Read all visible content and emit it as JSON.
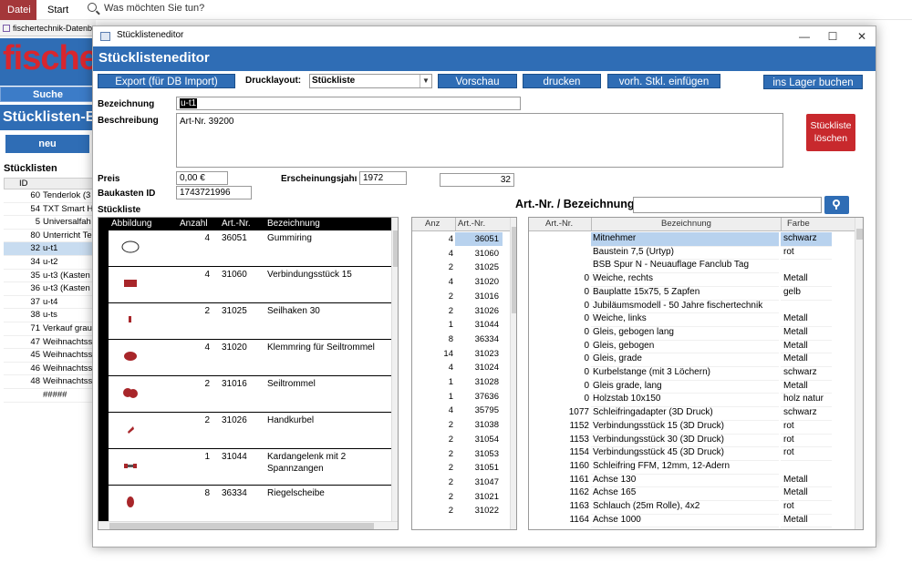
{
  "ribbon": {
    "datei": "Datei",
    "start": "Start",
    "tellme": "Was möchten Sie tun?"
  },
  "bg": {
    "tab": "fischertechnik-Datenb",
    "logo": "fische",
    "suche": "Suche",
    "title": "Stücklisten-Ed",
    "neu": "neu",
    "list_label": "Stücklisten",
    "id_header": "ID",
    "rows": [
      {
        "id": "60",
        "name": "Tenderlok (3"
      },
      {
        "id": "54",
        "name": "TXT Smart H"
      },
      {
        "id": "5",
        "name": "Universalfah"
      },
      {
        "id": "80",
        "name": "Unterricht Te"
      },
      {
        "id": "32",
        "name": "u-t1"
      },
      {
        "id": "34",
        "name": "u-t2"
      },
      {
        "id": "35",
        "name": "u-t3 (Kasten"
      },
      {
        "id": "36",
        "name": "u-t3 (Kasten"
      },
      {
        "id": "37",
        "name": "u-t4"
      },
      {
        "id": "38",
        "name": "u-ts"
      },
      {
        "id": "71",
        "name": "Verkauf grau"
      },
      {
        "id": "47",
        "name": "Weihnachtss"
      },
      {
        "id": "45",
        "name": "Weihnachtss"
      },
      {
        "id": "46",
        "name": "Weihnachtss"
      },
      {
        "id": "48",
        "name": "Weihnachtss"
      },
      {
        "id": "",
        "name": "#####"
      }
    ]
  },
  "dialog": {
    "window_title": "Stücklisteneditor",
    "header": "Stücklisteneditor",
    "buttons": {
      "export": "Export (für DB Import)",
      "vorschau": "Vorschau",
      "drucken": "drucken",
      "einfuegen": "vorh. Stkl. einfügen",
      "lager": "ins Lager buchen",
      "loeschen_1": "Stückliste",
      "loeschen_2": "löschen"
    },
    "drucklayout_label": "Drucklayout:",
    "drucklayout_value": "Stückliste",
    "bezeichnung_label": "Bezeichnung",
    "bezeichnung_value": "u-t1",
    "beschreibung_label": "Beschreibung",
    "beschreibung_value": "Art-Nr. 39200",
    "preis_label": "Preis",
    "preis_value": "0,00 €",
    "jahr_label": "Erscheinungsjahı",
    "jahr_value": "1972",
    "count_value": "32",
    "baukasten_label": "Baukasten ID",
    "baukasten_value": "1743721996",
    "search_label": "Art.-Nr. / Bezeichnung",
    "stueckliste_label": "Stückliste"
  },
  "grid1": {
    "headers": [
      "Abbildung",
      "Anzahl",
      "Art.-Nr.",
      "Bezeichnung"
    ],
    "rows": [
      {
        "anzahl": "4",
        "nr": "36051",
        "bez1": "Gummiring",
        "bez2": ""
      },
      {
        "anzahl": "4",
        "nr": "31060",
        "bez1": "Verbindungsstück 15",
        "bez2": ""
      },
      {
        "anzahl": "2",
        "nr": "31025",
        "bez1": "Seilhaken 30",
        "bez2": ""
      },
      {
        "anzahl": "4",
        "nr": "31020",
        "bez1": "Klemmring für Seiltrommel",
        "bez2": ""
      },
      {
        "anzahl": "2",
        "nr": "31016",
        "bez1": "Seiltrommel",
        "bez2": ""
      },
      {
        "anzahl": "2",
        "nr": "31026",
        "bez1": "Handkurbel",
        "bez2": ""
      },
      {
        "anzahl": "1",
        "nr": "31044",
        "bez1": "Kardangelenk mit 2",
        "bez2": "Spannzangen"
      },
      {
        "anzahl": "8",
        "nr": "36334",
        "bez1": "Riegelscheibe",
        "bez2": ""
      }
    ]
  },
  "grid2": {
    "headers": [
      "Anz",
      "Art.-Nr."
    ],
    "rows": [
      {
        "a": "4",
        "b": "36051"
      },
      {
        "a": "4",
        "b": "31060"
      },
      {
        "a": "2",
        "b": "31025"
      },
      {
        "a": "4",
        "b": "31020"
      },
      {
        "a": "2",
        "b": "31016"
      },
      {
        "a": "2",
        "b": "31026"
      },
      {
        "a": "1",
        "b": "31044"
      },
      {
        "a": "8",
        "b": "36334"
      },
      {
        "a": "14",
        "b": "31023"
      },
      {
        "a": "4",
        "b": "31024"
      },
      {
        "a": "1",
        "b": "31028"
      },
      {
        "a": "1",
        "b": "37636"
      },
      {
        "a": "4",
        "b": "35795"
      },
      {
        "a": "2",
        "b": "31038"
      },
      {
        "a": "2",
        "b": "31054"
      },
      {
        "a": "2",
        "b": "31053"
      },
      {
        "a": "2",
        "b": "31051"
      },
      {
        "a": "2",
        "b": "31047"
      },
      {
        "a": "2",
        "b": "31021"
      },
      {
        "a": "2",
        "b": "31022"
      }
    ]
  },
  "grid3": {
    "headers": [
      "Art.-Nr.",
      "Bezeichnung",
      "Farbe"
    ],
    "rows": [
      {
        "nr": "",
        "bez": "Mitnehmer",
        "farbe": "schwarz"
      },
      {
        "nr": "",
        "bez": "Baustein 7,5 (Urtyp)",
        "farbe": "rot"
      },
      {
        "nr": "",
        "bez": "BSB Spur N - Neuauflage Fanclub Tag",
        "farbe": ""
      },
      {
        "nr": "0",
        "bez": "Weiche, rechts",
        "farbe": "Metall"
      },
      {
        "nr": "0",
        "bez": "Bauplatte 15x75, 5 Zapfen",
        "farbe": "gelb"
      },
      {
        "nr": "0",
        "bez": "Jubiläumsmodell - 50 Jahre fischertechnik",
        "farbe": ""
      },
      {
        "nr": "0",
        "bez": "Weiche, links",
        "farbe": "Metall"
      },
      {
        "nr": "0",
        "bez": "Gleis, gebogen lang",
        "farbe": "Metall"
      },
      {
        "nr": "0",
        "bez": "Gleis, gebogen",
        "farbe": "Metall"
      },
      {
        "nr": "0",
        "bez": "Gleis, grade",
        "farbe": "Metall"
      },
      {
        "nr": "0",
        "bez": "Kurbelstange (mit 3 Löchern)",
        "farbe": "schwarz"
      },
      {
        "nr": "0",
        "bez": "Gleis grade, lang",
        "farbe": "Metall"
      },
      {
        "nr": "0",
        "bez": "Holzstab 10x150",
        "farbe": "holz natur"
      },
      {
        "nr": "1077",
        "bez": "Schleifringadapter (3D Druck)",
        "farbe": "schwarz"
      },
      {
        "nr": "1152",
        "bez": "Verbindungsstück 15 (3D Druck)",
        "farbe": "rot"
      },
      {
        "nr": "1153",
        "bez": "Verbindungsstück 30 (3D Druck)",
        "farbe": "rot"
      },
      {
        "nr": "1154",
        "bez": "Verbindungsstück 45 (3D Druck)",
        "farbe": "rot"
      },
      {
        "nr": "1160",
        "bez": "Schleifring FFM, 12mm, 12-Adern",
        "farbe": ""
      },
      {
        "nr": "1161",
        "bez": "Achse 130",
        "farbe": "Metall"
      },
      {
        "nr": "1162",
        "bez": "Achse 165",
        "farbe": "Metall"
      },
      {
        "nr": "1163",
        "bez": "Schlauch (25m Rolle), 4x2",
        "farbe": "rot"
      },
      {
        "nr": "1164",
        "bez": "Achse 1000",
        "farbe": "Metall"
      }
    ]
  },
  "colors": {
    "accent": "#2f6db5",
    "danger": "#c8292d",
    "ribbon_file": "#a4373a",
    "part_red": "#a8262a"
  }
}
